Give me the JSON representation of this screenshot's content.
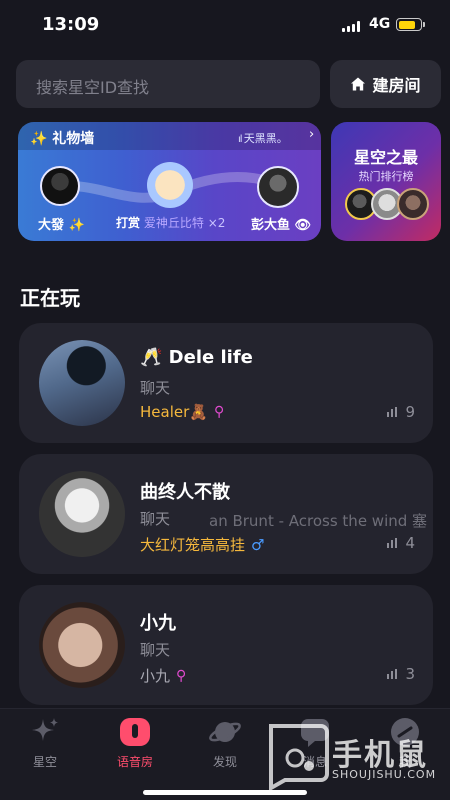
{
  "status_bar": {
    "time": "13:09",
    "network": "4G"
  },
  "search": {
    "placeholder": "搜索星空ID查找"
  },
  "create_room": {
    "label": "建房间"
  },
  "gift_wall": {
    "title": "✨ 礼物墙",
    "ticker": "天黑黑。",
    "sender": "大發 ✨",
    "verb": "打赏",
    "gift_name": "爱神丘比特",
    "gift_count": "×2",
    "receiver": "彭大鱼 👁"
  },
  "rank_card": {
    "title": "星空之最",
    "subtitle": "热门排行榜"
  },
  "section": {
    "title": "正在玩"
  },
  "rooms": [
    {
      "name": "🥂 Dele life",
      "category": "聊天",
      "host": "Healer🧸",
      "host_color": "#f5b83d",
      "gender": "female",
      "count": "9"
    },
    {
      "name": "曲终人不散",
      "category": "聊天",
      "now_playing": "an Brunt - Across the wind   塞",
      "host": "大红灯笼高高挂",
      "host_color": "#f5b83d",
      "gender": "male",
      "count": "4"
    },
    {
      "name": "小九",
      "category": "聊天",
      "host": "小九",
      "host_color": "#a9a9b3",
      "gender": "female",
      "count": "3"
    }
  ],
  "tabs": [
    {
      "label": "星空",
      "icon": "sparkle-icon",
      "active": false
    },
    {
      "label": "语音房",
      "icon": "voice-room-icon",
      "active": true
    },
    {
      "label": "发现",
      "icon": "planet-icon",
      "active": false
    },
    {
      "label": "消息",
      "icon": "message-icon",
      "active": false
    },
    {
      "label": "我",
      "icon": "profile-icon",
      "active": false
    }
  ],
  "watermark": {
    "text": "手机鼠",
    "url": "SHOUJISHU.COM"
  },
  "colors": {
    "background": "#17171f",
    "card": "#24242e",
    "accent": "#ff4d6d",
    "gold": "#f5b83d",
    "female": "#e24bd0",
    "male": "#4a9bff"
  }
}
